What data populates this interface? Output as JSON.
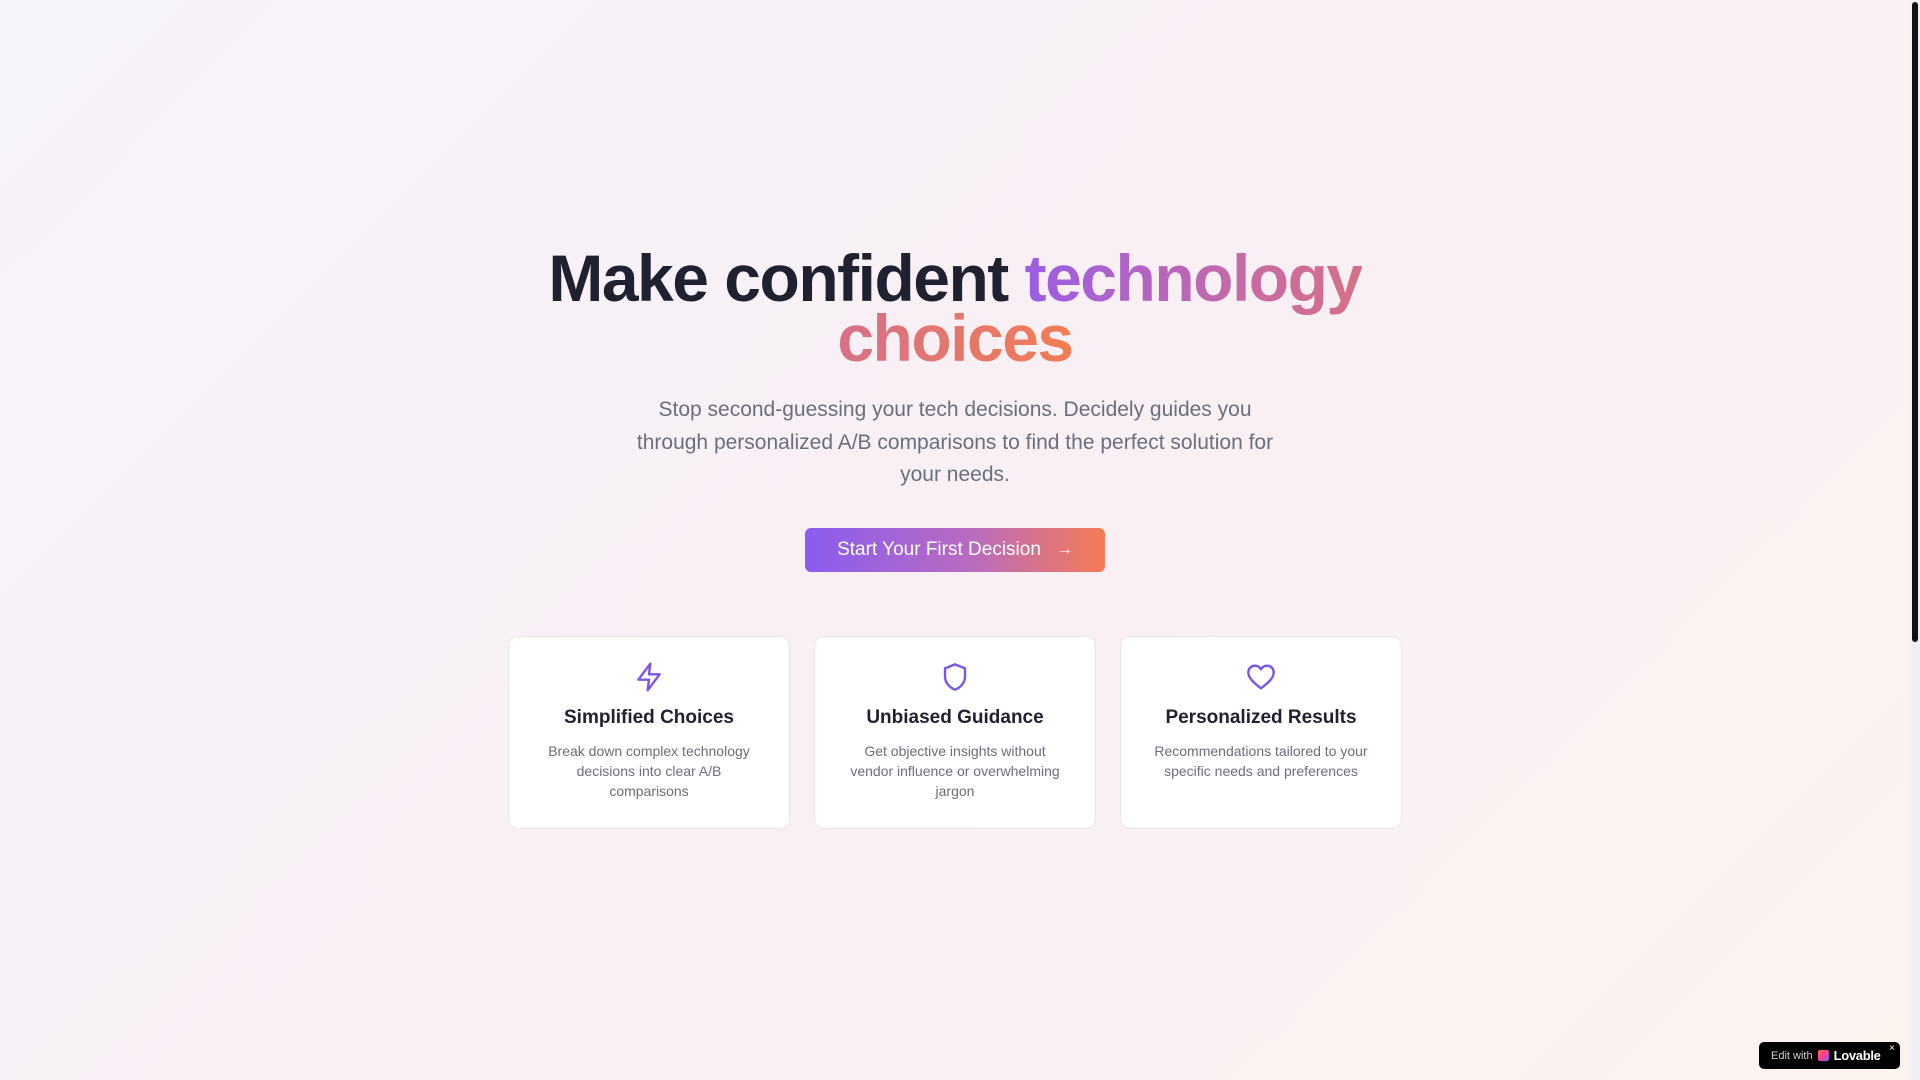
{
  "hero": {
    "title_plain": "Make confident ",
    "title_highlight": "technology choices",
    "subtitle": "Stop second-guessing your tech decisions. Decidely guides you through personalized A/B comparisons to find the perfect solution for your needs.",
    "cta_label": "Start Your First Decision"
  },
  "features": [
    {
      "icon": "lightning-icon",
      "title": "Simplified Choices",
      "text": "Break down complex technology decisions into clear A/B comparisons"
    },
    {
      "icon": "shield-icon",
      "title": "Unbiased Guidance",
      "text": "Get objective insights without vendor influence or overwhelming jargon"
    },
    {
      "icon": "heart-icon",
      "title": "Personalized Results",
      "text": "Recommendations tailored to your specific needs and preferences"
    }
  ],
  "badge": {
    "prefix": "Edit with",
    "brand": "Lovable",
    "close": "×"
  },
  "colors": {
    "accent_purple": "#8a5cf0",
    "accent_orange": "#f57b55",
    "icon_purple": "#7c55e6"
  }
}
